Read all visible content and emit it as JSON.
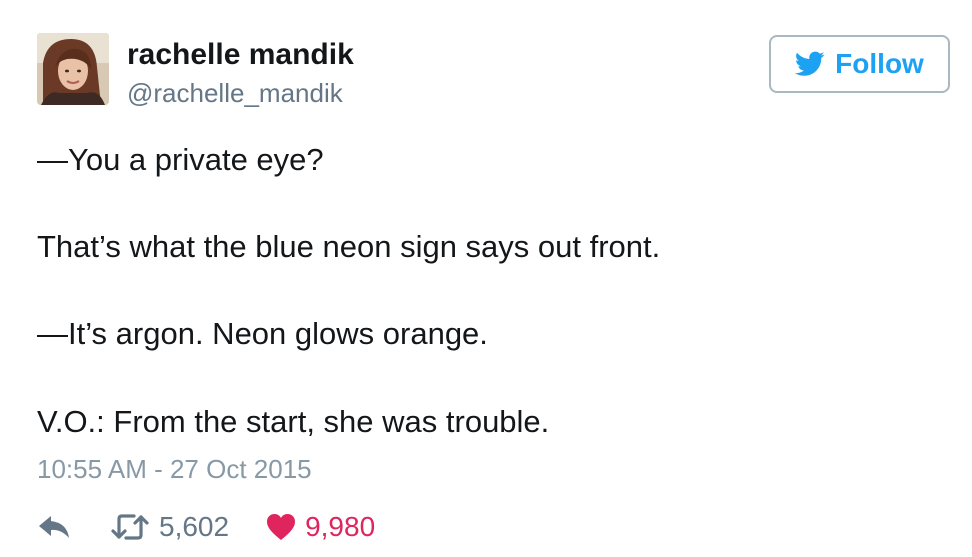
{
  "user": {
    "name": "rachelle mandik",
    "handle": "@rachelle_mandik"
  },
  "follow_button": {
    "label": "Follow"
  },
  "tweet": {
    "lines": [
      "—You a private eye?",
      "That’s what the blue neon sign says out front.",
      "—It’s argon. Neon glows orange.",
      "V.O.: From the start, she was trouble."
    ],
    "timestamp": "10:55 AM - 27 Oct 2015"
  },
  "actions": {
    "reply_icon": "reply-icon",
    "retweet_icon": "retweet-icon",
    "retweet_count": "5,602",
    "like_icon": "heart-icon",
    "like_count": "9,980"
  },
  "colors": {
    "accent": "#1da1f2",
    "like": "#e0245e",
    "muted": "#657786",
    "timestamp": "#8899a6"
  }
}
